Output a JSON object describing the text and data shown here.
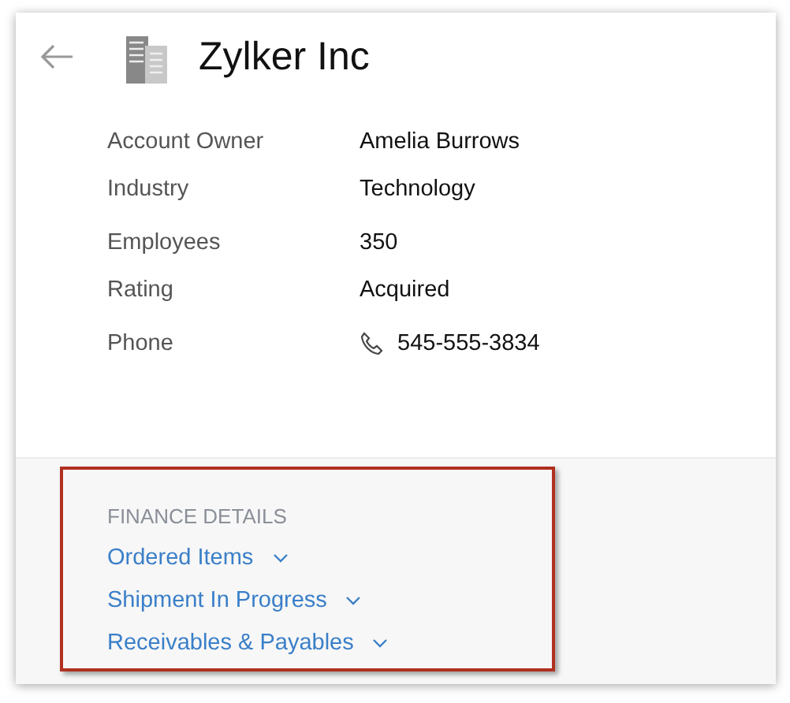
{
  "header": {
    "title": "Zylker Inc"
  },
  "field_groups": [
    [
      {
        "label": "Account Owner",
        "value": "Amelia Burrows",
        "kind": "text"
      },
      {
        "label": "Industry",
        "value": "Technology",
        "kind": "text"
      }
    ],
    [
      {
        "label": "Employees",
        "value": "350",
        "kind": "text"
      },
      {
        "label": "Rating",
        "value": "Acquired",
        "kind": "text"
      }
    ],
    [
      {
        "label": "Phone",
        "value": "545-555-3834",
        "kind": "phone"
      }
    ]
  ],
  "finance": {
    "heading": "FINANCE DETAILS",
    "items": [
      {
        "label": "Ordered Items",
        "expanded": false
      },
      {
        "label": "Shipment In Progress",
        "expanded": false
      },
      {
        "label": "Receivables & Payables",
        "expanded": false
      }
    ]
  }
}
